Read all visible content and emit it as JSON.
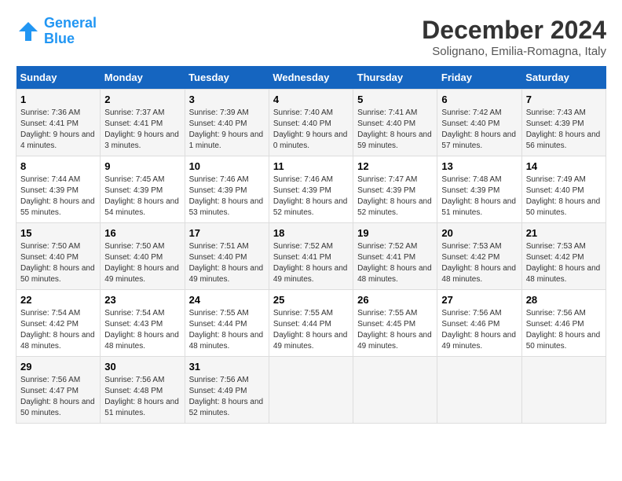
{
  "header": {
    "logo_line1": "General",
    "logo_line2": "Blue",
    "title": "December 2024",
    "subtitle": "Solignano, Emilia-Romagna, Italy"
  },
  "days_of_week": [
    "Sunday",
    "Monday",
    "Tuesday",
    "Wednesday",
    "Thursday",
    "Friday",
    "Saturday"
  ],
  "weeks": [
    [
      {
        "day": "1",
        "sunrise": "7:36 AM",
        "sunset": "4:41 PM",
        "daylight": "9 hours and 4 minutes."
      },
      {
        "day": "2",
        "sunrise": "7:37 AM",
        "sunset": "4:41 PM",
        "daylight": "9 hours and 3 minutes."
      },
      {
        "day": "3",
        "sunrise": "7:39 AM",
        "sunset": "4:40 PM",
        "daylight": "9 hours and 1 minute."
      },
      {
        "day": "4",
        "sunrise": "7:40 AM",
        "sunset": "4:40 PM",
        "daylight": "9 hours and 0 minutes."
      },
      {
        "day": "5",
        "sunrise": "7:41 AM",
        "sunset": "4:40 PM",
        "daylight": "8 hours and 59 minutes."
      },
      {
        "day": "6",
        "sunrise": "7:42 AM",
        "sunset": "4:40 PM",
        "daylight": "8 hours and 57 minutes."
      },
      {
        "day": "7",
        "sunrise": "7:43 AM",
        "sunset": "4:39 PM",
        "daylight": "8 hours and 56 minutes."
      }
    ],
    [
      {
        "day": "8",
        "sunrise": "7:44 AM",
        "sunset": "4:39 PM",
        "daylight": "8 hours and 55 minutes."
      },
      {
        "day": "9",
        "sunrise": "7:45 AM",
        "sunset": "4:39 PM",
        "daylight": "8 hours and 54 minutes."
      },
      {
        "day": "10",
        "sunrise": "7:46 AM",
        "sunset": "4:39 PM",
        "daylight": "8 hours and 53 minutes."
      },
      {
        "day": "11",
        "sunrise": "7:46 AM",
        "sunset": "4:39 PM",
        "daylight": "8 hours and 52 minutes."
      },
      {
        "day": "12",
        "sunrise": "7:47 AM",
        "sunset": "4:39 PM",
        "daylight": "8 hours and 52 minutes."
      },
      {
        "day": "13",
        "sunrise": "7:48 AM",
        "sunset": "4:39 PM",
        "daylight": "8 hours and 51 minutes."
      },
      {
        "day": "14",
        "sunrise": "7:49 AM",
        "sunset": "4:40 PM",
        "daylight": "8 hours and 50 minutes."
      }
    ],
    [
      {
        "day": "15",
        "sunrise": "7:50 AM",
        "sunset": "4:40 PM",
        "daylight": "8 hours and 50 minutes."
      },
      {
        "day": "16",
        "sunrise": "7:50 AM",
        "sunset": "4:40 PM",
        "daylight": "8 hours and 49 minutes."
      },
      {
        "day": "17",
        "sunrise": "7:51 AM",
        "sunset": "4:40 PM",
        "daylight": "8 hours and 49 minutes."
      },
      {
        "day": "18",
        "sunrise": "7:52 AM",
        "sunset": "4:41 PM",
        "daylight": "8 hours and 49 minutes."
      },
      {
        "day": "19",
        "sunrise": "7:52 AM",
        "sunset": "4:41 PM",
        "daylight": "8 hours and 48 minutes."
      },
      {
        "day": "20",
        "sunrise": "7:53 AM",
        "sunset": "4:42 PM",
        "daylight": "8 hours and 48 minutes."
      },
      {
        "day": "21",
        "sunrise": "7:53 AM",
        "sunset": "4:42 PM",
        "daylight": "8 hours and 48 minutes."
      }
    ],
    [
      {
        "day": "22",
        "sunrise": "7:54 AM",
        "sunset": "4:42 PM",
        "daylight": "8 hours and 48 minutes."
      },
      {
        "day": "23",
        "sunrise": "7:54 AM",
        "sunset": "4:43 PM",
        "daylight": "8 hours and 48 minutes."
      },
      {
        "day": "24",
        "sunrise": "7:55 AM",
        "sunset": "4:44 PM",
        "daylight": "8 hours and 48 minutes."
      },
      {
        "day": "25",
        "sunrise": "7:55 AM",
        "sunset": "4:44 PM",
        "daylight": "8 hours and 49 minutes."
      },
      {
        "day": "26",
        "sunrise": "7:55 AM",
        "sunset": "4:45 PM",
        "daylight": "8 hours and 49 minutes."
      },
      {
        "day": "27",
        "sunrise": "7:56 AM",
        "sunset": "4:46 PM",
        "daylight": "8 hours and 49 minutes."
      },
      {
        "day": "28",
        "sunrise": "7:56 AM",
        "sunset": "4:46 PM",
        "daylight": "8 hours and 50 minutes."
      }
    ],
    [
      {
        "day": "29",
        "sunrise": "7:56 AM",
        "sunset": "4:47 PM",
        "daylight": "8 hours and 50 minutes."
      },
      {
        "day": "30",
        "sunrise": "7:56 AM",
        "sunset": "4:48 PM",
        "daylight": "8 hours and 51 minutes."
      },
      {
        "day": "31",
        "sunrise": "7:56 AM",
        "sunset": "4:49 PM",
        "daylight": "8 hours and 52 minutes."
      },
      null,
      null,
      null,
      null
    ]
  ]
}
